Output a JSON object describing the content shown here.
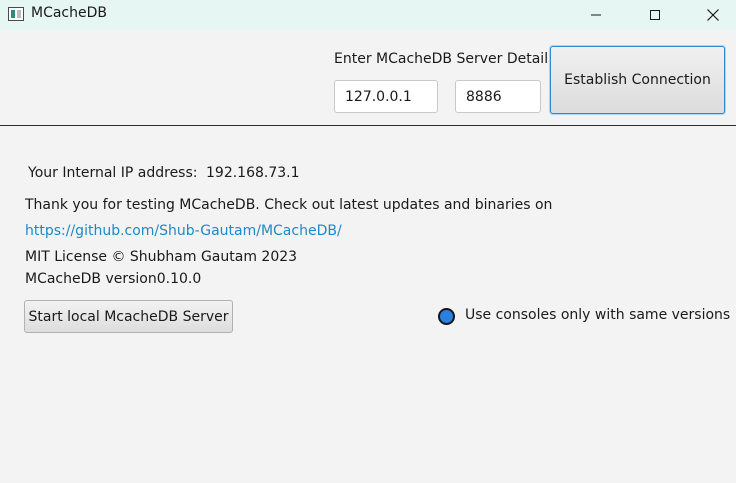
{
  "window": {
    "title": "MCacheDB",
    "icon": "app-icon",
    "controls": {
      "minimize": "minimize-icon",
      "maximize": "maximize-icon",
      "close": "close-icon"
    }
  },
  "toolbar": {
    "server_label": "Enter MCacheDB Server Details:",
    "host_value": "127.0.0.1",
    "port_value": "8886",
    "connect_label": "Establish Connection"
  },
  "info": {
    "ip_label": "Your Internal IP address:",
    "ip_value": "192.168.73.1",
    "thanks": "Thank you for testing MCacheDB. Check out latest updates and binaries on",
    "link": "https://github.com/Shub-Gautam/MCacheDB/",
    "license": "MIT License © Shubham Gautam  2023",
    "version": "MCacheDB version0.10.0"
  },
  "actions": {
    "start_local_label": "Start local McacheDB Server"
  },
  "status": {
    "text": "Use consoles only with same versions",
    "dot_color": "#2a7fe0"
  },
  "colors": {
    "link": "#1e88c8",
    "accent_border": "#2a8bd6",
    "titlebar_bg": "#e6f6f3"
  }
}
